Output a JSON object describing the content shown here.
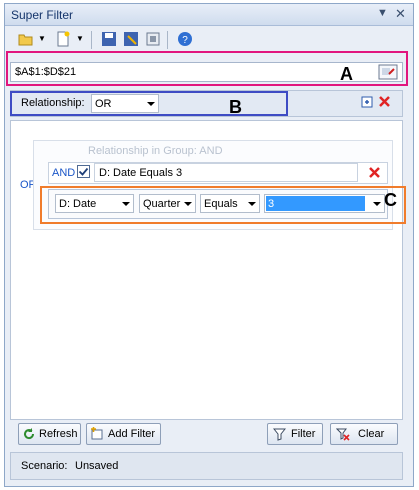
{
  "window": {
    "title": "Super Filter"
  },
  "range": {
    "value": "$A$1:$D$21"
  },
  "relationship": {
    "label": "Relationship:",
    "value": "OR"
  },
  "group": {
    "title": "Relationship in Group:   AND",
    "outer_relation": "OR",
    "inner_relation": "AND",
    "condition_text": "D: Date  Equals  3",
    "condition_checked": true
  },
  "condition_row": {
    "column": "D: Date",
    "period": "Quarter",
    "operator": "Equals",
    "value": "3"
  },
  "callouts": {
    "a": "A",
    "b": "B",
    "c": "C"
  },
  "buttons": {
    "refresh": "Refresh",
    "add_filter": "Add Filter",
    "filter": "Filter",
    "clear": "Clear"
  },
  "status": {
    "scenario_label": "Scenario:",
    "scenario_value": "Unsaved"
  },
  "colors": {
    "accent": "#1a56c8",
    "highlight_a": "#e1167e",
    "highlight_b": "#3e4cc4",
    "highlight_c": "#f07c2c"
  }
}
